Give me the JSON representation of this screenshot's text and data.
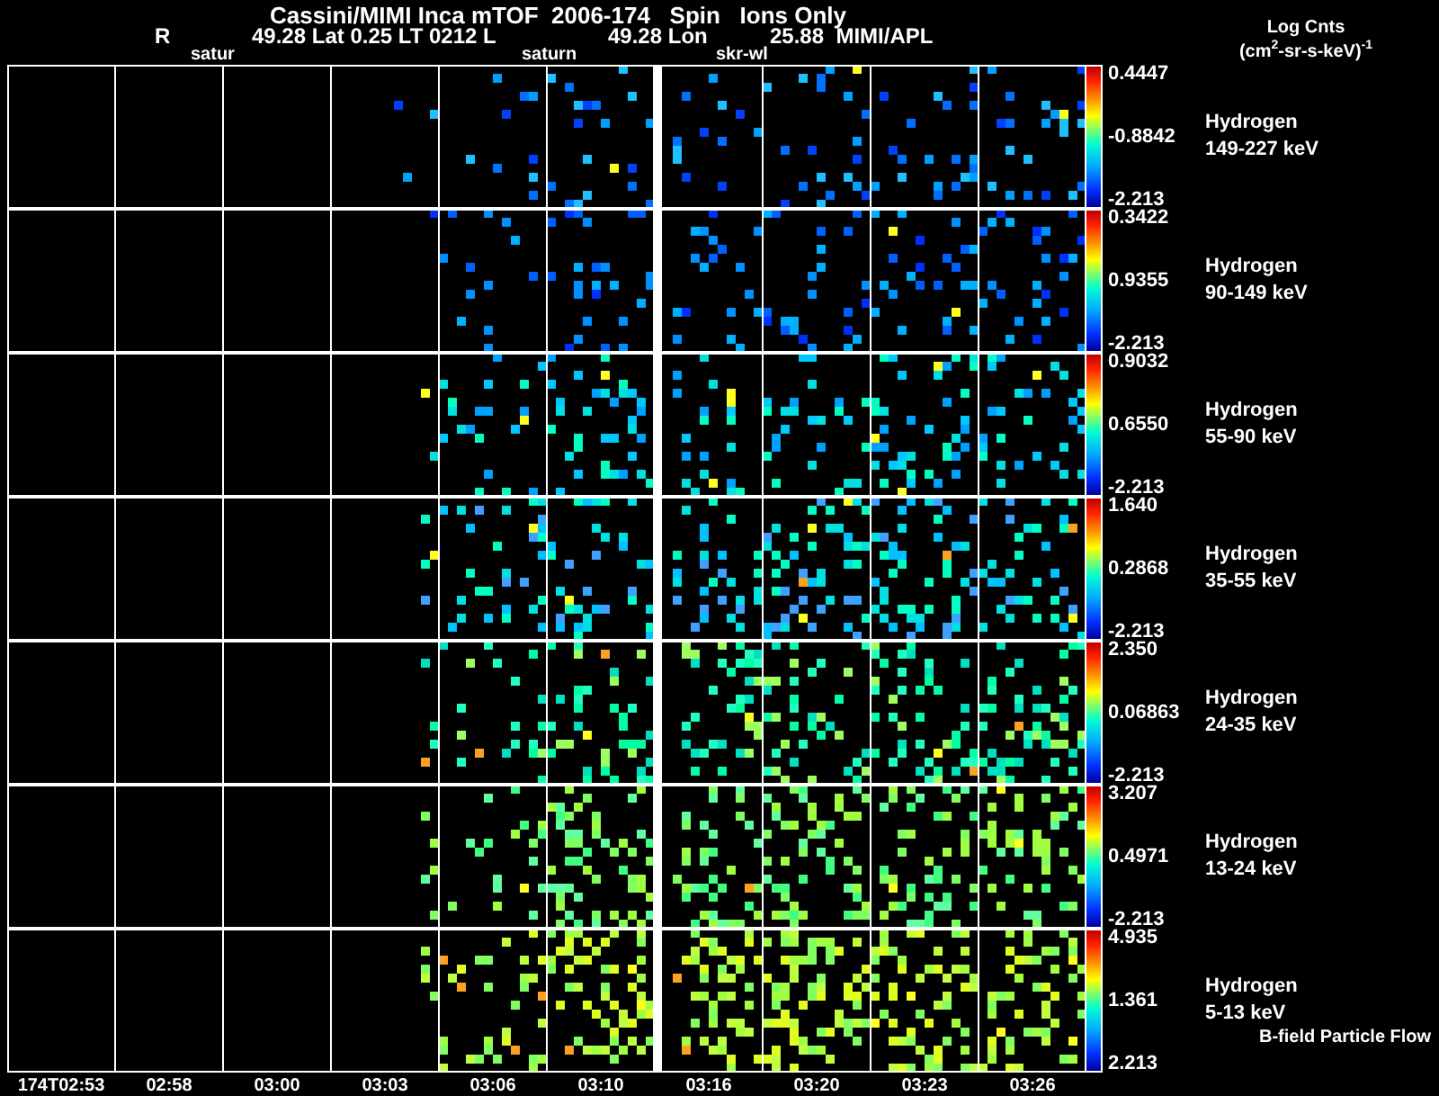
{
  "title": {
    "main": "Cassini/MIMI Inca mTOF  2006-174   Spin   Ions Only",
    "ephemeris": [
      "R",
      "49.28 Lat 0.25 LT 0212 L",
      "49.28 Lon",
      "25.88  MIMI/APL"
    ],
    "markers": [
      "satur",
      "saturn",
      "skr-wl"
    ]
  },
  "colorbar_title": [
    "Log Cnts",
    "(cm$^{2}$-sr-s-keV)$^{-1}$"
  ],
  "panels": [
    {
      "species": "Hydrogen",
      "energy": "149-227 keV",
      "max": "0.4447",
      "mid": "-0.8842",
      "min": "-2.213"
    },
    {
      "species": "Hydrogen",
      "energy": "90-149 keV",
      "max": "0.3422",
      "mid": "0.9355",
      "min": "-2.213"
    },
    {
      "species": "Hydrogen",
      "energy": "55-90 keV",
      "max": "0.9032",
      "mid": "0.6550",
      "min": "-2.213"
    },
    {
      "species": "Hydrogen",
      "energy": "35-55 keV",
      "max": "1.640",
      "mid": "0.2868",
      "min": "-2.213"
    },
    {
      "species": "Hydrogen",
      "energy": "24-35 keV",
      "max": "2.350",
      "mid": "0.06863",
      "min": "-2.213"
    },
    {
      "species": "Hydrogen",
      "energy": "13-24 keV",
      "max": "3.207",
      "mid": "0.4971",
      "min": "-2.213"
    },
    {
      "species": "Hydrogen",
      "energy": "5-13 keV",
      "max": "4.935",
      "mid": "1.361",
      "min": "2.213"
    }
  ],
  "footer": "B-field Particle Flow",
  "time_axis": [
    "174T02:53",
    "02:58",
    "03:00",
    "03:03",
    "03:06",
    "03:10",
    "03:16",
    "03:20",
    "03:23",
    "03:26"
  ]
}
